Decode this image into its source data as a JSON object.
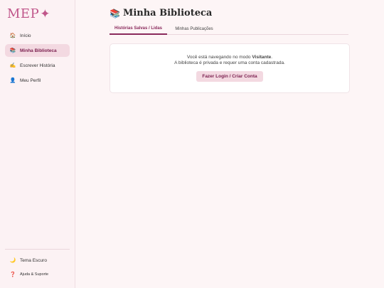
{
  "app": {
    "logo": "MEP",
    "logo_mark": "✦"
  },
  "sidebar": {
    "items": [
      {
        "icon": "🏠",
        "icon_name": "home-icon",
        "label": "Início",
        "active": false
      },
      {
        "icon": "📚",
        "icon_name": "books-icon",
        "label": "Minha Biblioteca",
        "active": true
      },
      {
        "icon": "✍️",
        "icon_name": "writing-hand-icon",
        "label": "Escrever História",
        "active": false
      },
      {
        "icon": "👤",
        "icon_name": "user-icon",
        "label": "Meu Perfil",
        "active": false
      }
    ],
    "bottom": [
      {
        "icon": "🌙",
        "icon_name": "moon-icon",
        "label": "Tema Escuro"
      },
      {
        "icon": "❓",
        "icon_name": "help-icon",
        "label": "Ajuda & Suporte"
      }
    ]
  },
  "main": {
    "title_icon": "📚",
    "title": "Minha Biblioteca",
    "tabs": [
      {
        "label": "Histórias Salvas / Lidas",
        "active": true
      },
      {
        "label": "Minhas Publicações",
        "active": false
      }
    ],
    "notice": {
      "line1_prefix": "Você está navegando no modo ",
      "line1_bold": "Visitante",
      "line1_suffix": ".",
      "line2": "A biblioteca é privada e requer uma conta cadastrada.",
      "button": "Fazer Login / Criar Conta"
    }
  },
  "colors": {
    "accent": "#8a2a5c",
    "logo": "#c0568a",
    "active_bg": "#f3d9e1",
    "page_bg": "#fdf5f6"
  }
}
